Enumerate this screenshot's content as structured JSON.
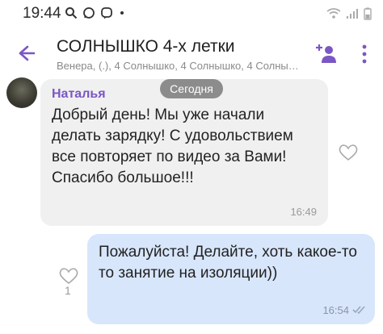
{
  "status_bar": {
    "time": "19:44",
    "icons": [
      "search-icon",
      "whatsapp-icon",
      "viber-icon",
      "dot-icon",
      "wifi-icon",
      "signal-icon",
      "battery-icon"
    ]
  },
  "chat_header": {
    "title": "СОЛНЫШКО 4-х летки",
    "participants": "Венера, (.), 4 Солнышко, 4 Солнышко, 4 Солнышко, 4 Солн...",
    "accent_color": "#7a57c4"
  },
  "date_separator": "Сегодня",
  "messages": [
    {
      "sender": "Наталья",
      "text": "Добрый день! Мы уже начали делать зарядку! С удовольствием все повторяет по видео за Вами! Спасибо большое!!!",
      "time": "16:49"
    },
    {
      "text": "Пожалуйста! Делайте, хоть какое-то то занятие на изоляции))",
      "time": "16:54",
      "likes": "1"
    }
  ]
}
